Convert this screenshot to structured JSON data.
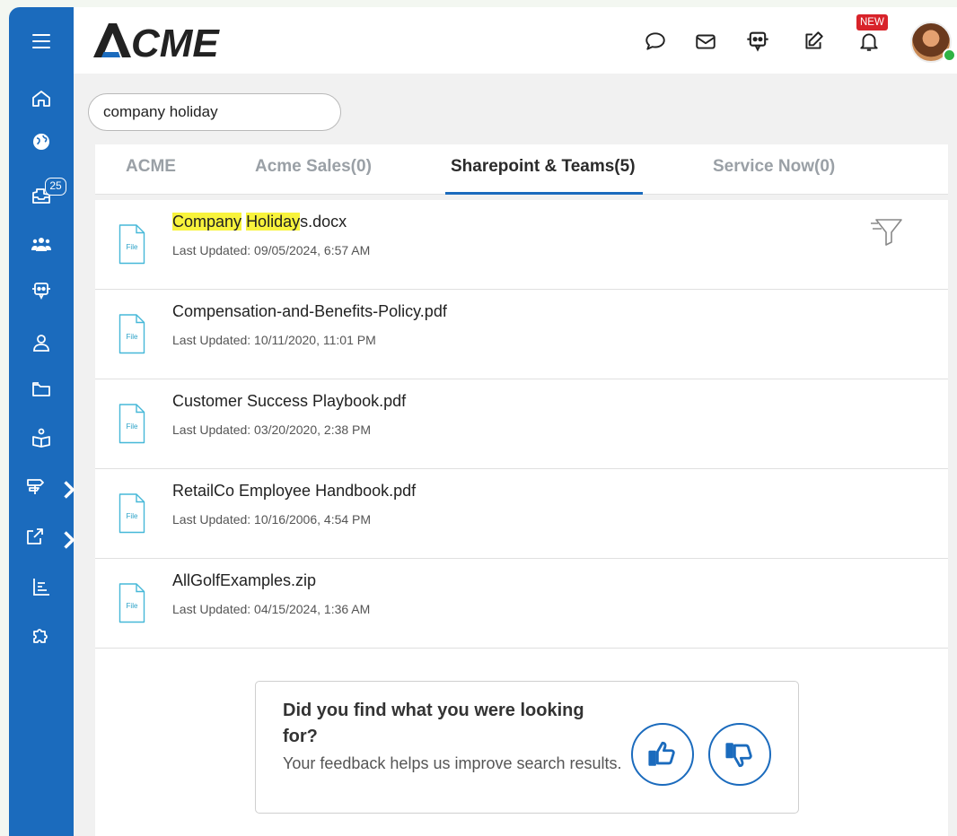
{
  "app": {
    "logo_text": "ACME",
    "new_badge": "NEW"
  },
  "sidebar": {
    "items": [
      {
        "icon": "menu-icon"
      },
      {
        "icon": "home-icon"
      },
      {
        "icon": "globe-icon"
      },
      {
        "icon": "inbox-icon",
        "badge": "25"
      },
      {
        "icon": "users-icon"
      },
      {
        "icon": "chatbot-icon"
      },
      {
        "icon": "user-icon"
      },
      {
        "icon": "folder-icon"
      },
      {
        "icon": "knowledge-icon"
      },
      {
        "icon": "signpost-icon"
      },
      {
        "icon": "external-link-icon"
      },
      {
        "icon": "report-icon"
      },
      {
        "icon": "puzzle-icon"
      }
    ]
  },
  "search": {
    "value": "company holiday"
  },
  "tabs": [
    {
      "label": "ACME"
    },
    {
      "label": "Acme Sales(0)"
    },
    {
      "label": "Sharepoint & Teams(5)"
    },
    {
      "label": "Service Now(0)"
    }
  ],
  "results": [
    {
      "name_parts": [
        "Company",
        " ",
        "Holiday",
        "s.docx"
      ],
      "date": "Last Updated: 09/05/2024, 6:57 AM",
      "file_label": "File"
    },
    {
      "name": "Compensation-and-Benefits-Policy.pdf",
      "date": "Last Updated: 10/11/2020, 11:01 PM",
      "file_label": "File"
    },
    {
      "name": "Customer Success Playbook.pdf",
      "date": "Last Updated: 03/20/2020, 2:38 PM",
      "file_label": "File"
    },
    {
      "name": "RetailCo Employee Handbook.pdf",
      "date": "Last Updated: 10/16/2006, 4:54 PM",
      "file_label": "File"
    },
    {
      "name": "AllGolfExamples.zip",
      "date": "Last Updated: 04/15/2024, 1:36 AM",
      "file_label": "File"
    }
  ],
  "feedback": {
    "title": "Did you find what you were looking for?",
    "subtitle": "Your feedback helps us improve search results."
  },
  "colors": {
    "brand_blue": "#1b6bbd",
    "highlight": "#f8f33c",
    "new_badge": "#d8232a",
    "online": "#2fb344"
  }
}
